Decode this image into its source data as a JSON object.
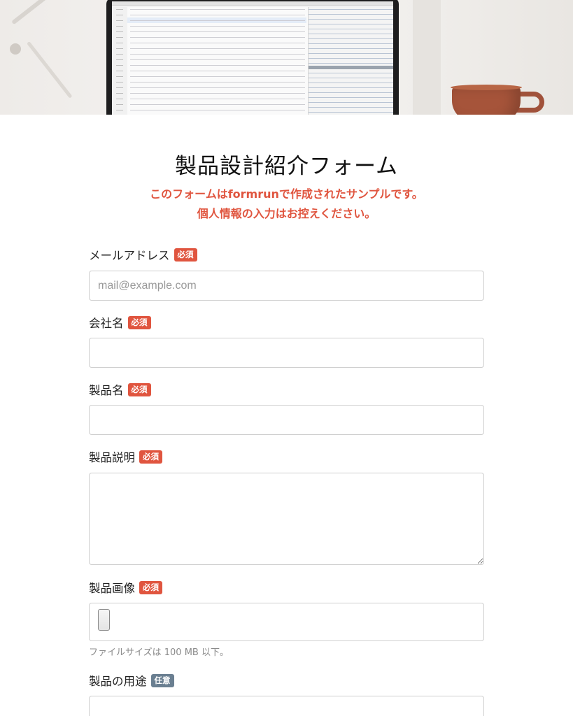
{
  "form": {
    "title": "製品設計紹介フォーム",
    "notice_line1": "このフォームはformrunで作成されたサンプルです。",
    "notice_line2": "個人情報の入力はお控えください。"
  },
  "fields": {
    "email": {
      "label": "メールアドレス",
      "badge": "必須",
      "placeholder": "mail@example.com",
      "value": ""
    },
    "company": {
      "label": "会社名",
      "badge": "必須",
      "value": ""
    },
    "product_name": {
      "label": "製品名",
      "badge": "必須",
      "value": ""
    },
    "product_description": {
      "label": "製品説明",
      "badge": "必須",
      "value": ""
    },
    "product_image": {
      "label": "製品画像",
      "badge": "必須",
      "hint": "ファイルサイズは 100 MB 以下。"
    },
    "product_usage": {
      "label": "製品の用途",
      "badge": "任意",
      "value": ""
    }
  },
  "colors": {
    "required_badge": "#e0553f",
    "optional_badge": "#6a7f91",
    "notice_text": "#e0553f"
  }
}
